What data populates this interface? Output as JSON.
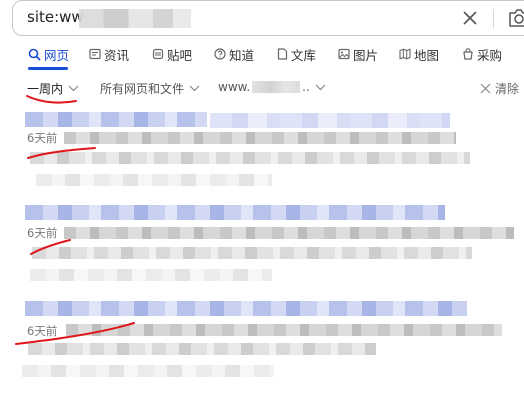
{
  "search": {
    "query_visible": "site:ww"
  },
  "tabs": [
    {
      "label": "网页",
      "icon": "search-icon",
      "active": true
    },
    {
      "label": "资讯",
      "icon": "news-icon"
    },
    {
      "label": "贴吧",
      "icon": "tieba-icon"
    },
    {
      "label": "知道",
      "icon": "question-icon"
    },
    {
      "label": "文库",
      "icon": "document-icon"
    },
    {
      "label": "图片",
      "icon": "image-icon"
    },
    {
      "label": "地图",
      "icon": "map-icon"
    },
    {
      "label": "采购",
      "icon": "purchase-icon"
    }
  ],
  "filters": {
    "time": "一周内",
    "type": "所有网页和文件",
    "site_prefix": "www.",
    "site_suffix": "..",
    "clear": "清除"
  },
  "results": [
    {
      "date": "6天前"
    },
    {
      "date": "6天前"
    },
    {
      "date": "6天前"
    }
  ],
  "colors": {
    "accent": "#1a4dd8",
    "annotation": "#e0161b"
  }
}
